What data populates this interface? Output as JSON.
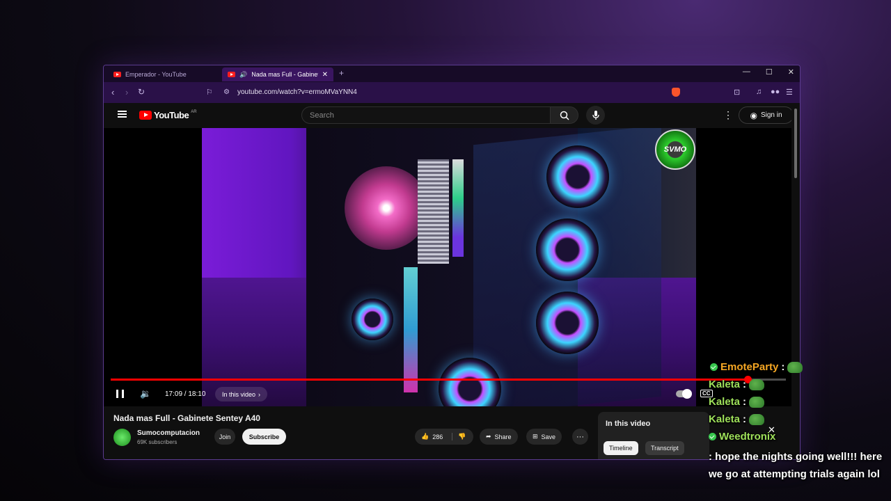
{
  "browser": {
    "tabs": [
      {
        "label": "Emperador - YouTube",
        "active": false
      },
      {
        "label": "Nada mas Full - Gabinete Sent",
        "active": true
      }
    ],
    "url": "youtube.com/watch?v=ermoMVaYNN4"
  },
  "youtube": {
    "logo_text": "YouTube",
    "country": "AR",
    "search_placeholder": "Search",
    "sign_in": "Sign in"
  },
  "player": {
    "time": "17:09 / 18:10",
    "progress": 0.943,
    "chapter_label": "In this video",
    "watermark": "SVMO"
  },
  "video": {
    "title": "Nada mas Full - Gabinete Sentey A40",
    "channel": "Sumocomputacion",
    "subscribers": "69K subscribers",
    "join": "Join",
    "subscribe": "Subscribe",
    "likes": "286",
    "share": "Share",
    "save": "Save"
  },
  "side_panel": {
    "title": "In this video",
    "tabs": [
      "Timeline",
      "Transcript"
    ]
  },
  "chat": [
    {
      "user": "EmoteParty",
      "color": "#f5a623",
      "message": ":",
      "emote": true
    },
    {
      "user": "Kaleta",
      "color": "#9ee05a",
      "message": ":",
      "emote": true
    },
    {
      "user": "Kaleta",
      "color": "#9ee05a",
      "message": ":",
      "emote": true
    },
    {
      "user": "Kaleta",
      "color": "#9ee05a",
      "message": ":",
      "emote": true
    },
    {
      "user": "Weedtronix",
      "color": "#9ee05a",
      "message": ": hope the nights going well!!! here we go at attempting trials again lol",
      "emote": false
    }
  ]
}
